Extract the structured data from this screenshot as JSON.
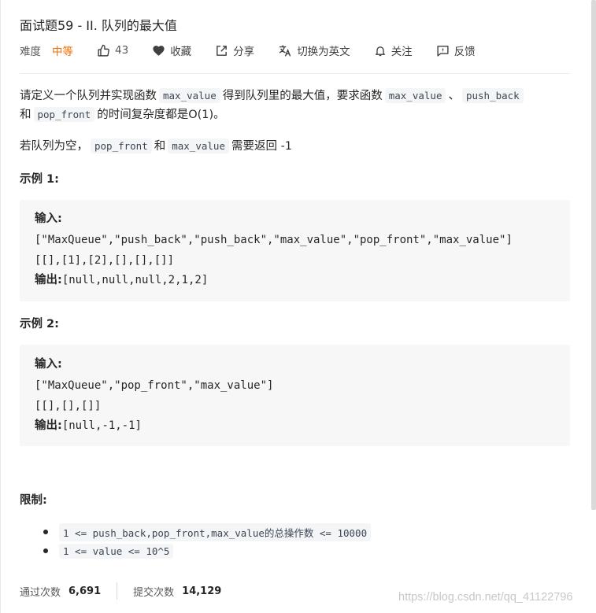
{
  "problem": {
    "title": "面试题59 - II. 队列的最大值",
    "difficulty_label": "难度",
    "difficulty": "中等",
    "likes": "43",
    "favorite_label": "收藏",
    "share_label": "分享",
    "switch_lang_label": "切换为英文",
    "follow_label": "关注",
    "feedback_label": "反馈"
  },
  "description": {
    "p1_text1": "请定义一个队列并实现函数",
    "p1_code1": "max_value",
    "p1_text2": "得到队列里的最大值，要求函数",
    "p1_code2": "max_value",
    "p1_text3": "、",
    "p1_code3": "push_back",
    "p1_text4": "和",
    "p1_code4": "pop_front",
    "p1_text5": "的时间复杂度都是O(1)。",
    "p2_text1": "若队列为空，",
    "p2_code1": "pop_front",
    "p2_text2": "和",
    "p2_code2": "max_value",
    "p2_text3": "需要返回 -1"
  },
  "examples": [
    {
      "heading": "示例 1:",
      "input_label": "输入:",
      "input_line1": "[\"MaxQueue\",\"push_back\",\"push_back\",\"max_value\",\"pop_front\",\"max_value\"]",
      "input_line2": "[[],[1],[2],[],[],[]]",
      "output_label": "输出:",
      "output": "[null,null,null,2,1,2]"
    },
    {
      "heading": "示例 2:",
      "input_label": "输入:",
      "input_line1": "[\"MaxQueue\",\"pop_front\",\"max_value\"]",
      "input_line2": "[[],[],[]]",
      "output_label": "输出:",
      "output": "[null,-1,-1]"
    }
  ],
  "constraints": {
    "heading": "限制:",
    "items": [
      "1 <= push_back,pop_front,max_value的总操作数  <= 10000",
      "1 <= value <= 10^5"
    ]
  },
  "stats": {
    "accepted_label": "通过次数",
    "accepted": "6,691",
    "submissions_label": "提交次数",
    "submissions": "14,129"
  },
  "watermark": "https://blog.csdn.net/qq_41122796",
  "colors": {
    "difficulty_medium": "#ef6c00",
    "code_bg": "#f4f5f7",
    "block_bg": "#f7f7f8"
  }
}
